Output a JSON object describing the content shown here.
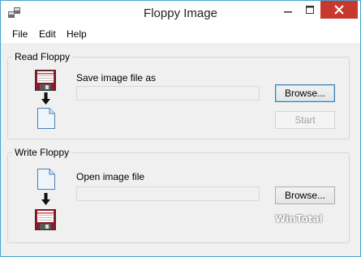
{
  "window": {
    "title": "Floppy Image",
    "accent_color": "#c7392f",
    "controls": {
      "minimize": "minimize-icon",
      "maximize": "maximize-icon",
      "close": "close-icon"
    }
  },
  "menu": {
    "items": [
      {
        "label": "File"
      },
      {
        "label": "Edit"
      },
      {
        "label": "Help"
      }
    ]
  },
  "read_floppy": {
    "group_label": "Read Floppy",
    "field_label": "Save image file as",
    "field_value": "",
    "browse_label": "Browse...",
    "start_label": "Start",
    "icons": [
      "floppy-disk-icon",
      "arrow-down-icon",
      "document-icon"
    ]
  },
  "write_floppy": {
    "group_label": "Write Floppy",
    "field_label": "Open image file",
    "field_value": "",
    "browse_label": "Browse...",
    "icons": [
      "document-icon",
      "arrow-down-icon",
      "floppy-disk-icon"
    ]
  },
  "watermark": {
    "text": "WinTotal"
  }
}
